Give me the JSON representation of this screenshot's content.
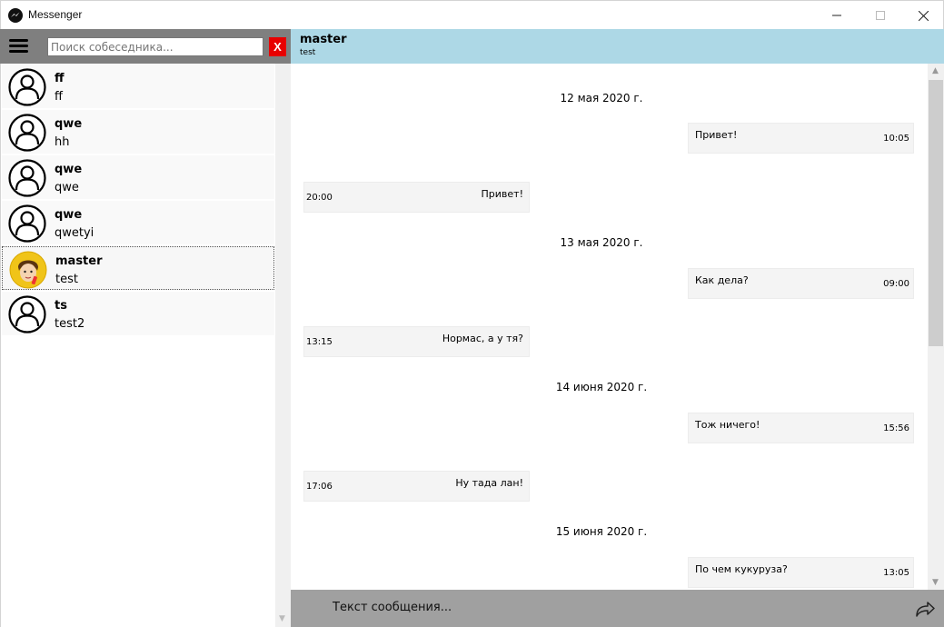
{
  "window": {
    "title": "Messenger",
    "app_icon": "messenger-icon"
  },
  "search": {
    "placeholder": "Поиск собеседника...",
    "clear_label": "X"
  },
  "contacts": [
    {
      "name": "ff",
      "last": "ff",
      "avatar": "default-user-icon"
    },
    {
      "name": "qwe",
      "last": "hh",
      "avatar": "default-user-icon"
    },
    {
      "name": "qwe",
      "last": "qwe",
      "avatar": "default-user-icon"
    },
    {
      "name": "qwe",
      "last": "qwetyi",
      "avatar": "default-user-icon"
    },
    {
      "name": "master",
      "last": "test",
      "avatar": "cartoon-photo"
    },
    {
      "name": "ts",
      "last": "test2",
      "avatar": "default-user-icon"
    }
  ],
  "chat": {
    "title": "master",
    "subtitle": "test"
  },
  "dates": [
    "12 мая 2020 г.",
    "13 мая 2020 г.",
    "14 июня 2020 г.",
    "15 июня 2020 г."
  ],
  "messages": [
    {
      "text": "Привет!",
      "time": "10:05",
      "direction": "out"
    },
    {
      "text": "Привет!",
      "time": "20:00",
      "direction": "in"
    },
    {
      "text": "Как дела?",
      "time": "09:00",
      "direction": "out"
    },
    {
      "text": "Нормас, а у тя?",
      "time": "13:15",
      "direction": "in"
    },
    {
      "text": "Тож ничего!",
      "time": "15:56",
      "direction": "out"
    },
    {
      "text": "Ну тада лан!",
      "time": "17:06",
      "direction": "in"
    },
    {
      "text": "По чем кукуруза?",
      "time": "13:05",
      "direction": "out"
    }
  ],
  "composer": {
    "placeholder": "Текст сообщения..."
  },
  "colors": {
    "chat_header": "#add8e6",
    "left_header": "#7f7f7f",
    "composer": "#a0a0a0",
    "clear_button": "#e80000",
    "bubble": "#f4f4f4"
  }
}
